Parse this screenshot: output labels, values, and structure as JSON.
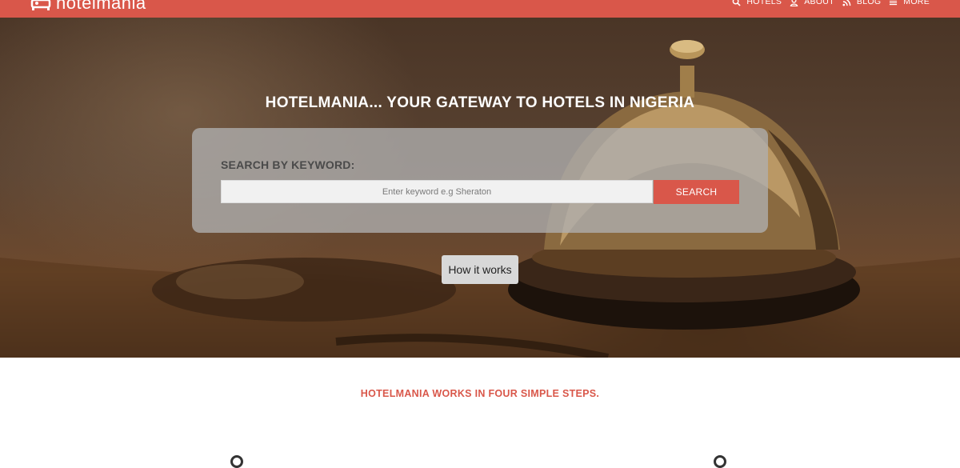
{
  "brand": {
    "name": "hotelmania",
    "color": "#d9574a"
  },
  "nav": {
    "items": [
      {
        "label": "HOTELS",
        "icon": "search-icon"
      },
      {
        "label": "ABOUT",
        "icon": "user-icon"
      },
      {
        "label": "BLOG",
        "icon": "rss-icon"
      },
      {
        "label": "MORE",
        "icon": "menu-icon"
      }
    ]
  },
  "hero": {
    "title": "HOTELMANIA... YOUR GATEWAY TO HOTELS IN NIGERIA",
    "search": {
      "label": "SEARCH BY KEYWORD:",
      "placeholder": "Enter keyword e.g Sheraton",
      "value": "",
      "button_label": "SEARCH"
    },
    "how_it_works_label": "How it works"
  },
  "steps": {
    "title": "HOTELMANIA WORKS IN FOUR SIMPLE STEPS."
  }
}
